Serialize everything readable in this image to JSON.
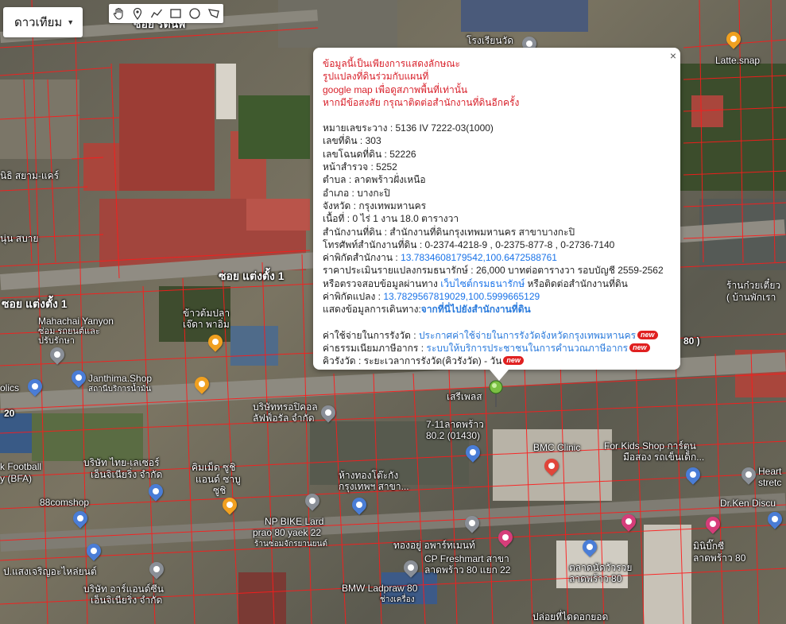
{
  "map_type": {
    "label": "ดาวเทียม"
  },
  "toolbar": {
    "tools": [
      {
        "name": "hand-tool",
        "icon": "hand-icon"
      },
      {
        "name": "marker-tool",
        "icon": "marker-icon"
      },
      {
        "name": "polyline-tool",
        "icon": "polyline-icon"
      },
      {
        "name": "rectangle-tool",
        "icon": "rectangle-icon"
      },
      {
        "name": "circle-tool",
        "icon": "circle-icon"
      },
      {
        "name": "polygon-tool",
        "icon": "polygon-icon"
      }
    ]
  },
  "info": {
    "close": "×",
    "disclaimer": [
      "ข้อมูลนี้เป็นเพียงการแสดงลักษณะ",
      "รูปแปลงที่ดินร่วมกับแผนที่",
      "google map เพื่อดูสภาพพื้นที่เท่านั้น",
      "หากมีข้อสงสัย กรุณาติดต่อสำนักงานที่ดินอีกครั้ง"
    ],
    "fields": [
      {
        "label": "หมายเลขระวาง",
        "value": "5136 IV 7222-03(1000)"
      },
      {
        "label": "เลขที่ดิน",
        "value": "303"
      },
      {
        "label": "เลขโฉนดที่ดิน",
        "value": "52226"
      },
      {
        "label": "หน้าสำรวจ",
        "value": "5252"
      },
      {
        "label": "ตำบล",
        "value": "ลาดพร้าวฝั่งเหนือ"
      },
      {
        "label": "อำเภอ",
        "value": "บางกะปิ"
      },
      {
        "label": "จังหวัด",
        "value": "กรุงเทพมหานคร"
      },
      {
        "label": "เนื้อที่",
        "value": "0 ไร่ 1 งาน 18.0 ตารางวา"
      },
      {
        "label": "สำนักงานที่ดิน",
        "value": "สำนักงานที่ดินกรุงเทพมหานคร สาขาบางกะปิ"
      },
      {
        "label": "โทรศัพท์สำนักงานที่ดิน",
        "value": "0-2374-4218-9 , 0-2375-877-8 , 0-2736-7140"
      }
    ],
    "office_coord_label": "ค่าพิกัดสำนักงาน",
    "office_coord": "13.7834608179542,100.6472588761",
    "price_label": "ราคาประเมินรายแปลงกรมธนารักษ์",
    "price_value": "26,000 บาทต่อตารางวา รอบบัญชี 2559-2562",
    "check_prefix": "หรือตรวจสอบข้อมูลผ่านทาง",
    "check_link": "เว็บไซต์กรมธนารักษ์",
    "check_suffix": "หรือติดต่อสำนักงานที่ดิน",
    "parcel_coord_label": "ค่าพิกัดแปลง",
    "parcel_coord": "13.7829567819029,100.5999665129",
    "route_label": "แสดงข้อมูลการเดินทาง:",
    "route_link": "จากที่นี่ไปยังสำนักงานที่ดิน",
    "fees": [
      {
        "label": "ค่าใช้จ่ายในการรังวัด",
        "value": "ประกาศค่าใช้จ่ายในการรังวัดจังหวัดกรุงเทพมหานคร",
        "badge": "new"
      },
      {
        "label": "ค่าธรรมเนียมภาษีอากร",
        "value": "ระบบให้บริการประชาชนในการคำนวณภาษีอากร",
        "badge": "new"
      },
      {
        "label": "คิวรังวัด",
        "value": "ระยะเวลาการรังวัด(คิวรังวัด) - วัน",
        "badge": "new"
      }
    ]
  },
  "places": {
    "school": "โรงเรียนวัด",
    "latte": "Latte.snap",
    "mahachai": "Mahachai Yanyon",
    "mahachai2": "ซ่อม รถยนต์และ",
    "mahachai3": "ปรับรักษา",
    "khao": "ข้าวต้มปลา",
    "khao2": "เจ๊ดา พาอิ่ม",
    "janthima": "Janthima.Shop",
    "janthima2": "สถานีบริการน้ำมัน",
    "company": "บริษัททรอปิคอล",
    "company2": "ลัฟฟ์อรัล จำกัด",
    "seri": "เสรีเพลส",
    "seven": "7-11ลาดพร้าว",
    "seven2": "80.2 (01430)",
    "bmc": "BMC Clinic",
    "kids": "For Kids Shop การ์ตูน",
    "kids2": "มือสอง รถเข็นเด็ก...",
    "heart": "Heart",
    "heart2": "stretc",
    "thai_laser": "บริษัท ไทย-เลเซอร์",
    "thai_laser2": "เอ็นจิเนียริ่ง จำกัด",
    "computer": "คิมเม็ด ซูชิ",
    "computer2": "แอนด์ ซาบู",
    "computer3": "ซูชิ",
    "gold": "ห้างทองโต๊ะกัง",
    "gold2": "กรุงเทพฯ สาขา...",
    "comshop": "88comshop",
    "npbike": "NP BIKE Lard",
    "npbike2": "prao 80 yaek 22",
    "npbike3": "ร้านซ่อมจักรยานยนต์",
    "drken": "Dr.Ken Discu",
    "thongyoo": "ทองอยู่ อพาร์ทเมนท์",
    "cp": "CP Freshmart สาขา",
    "cp2": "ลาดพร้าว 80 แยก 22",
    "mini": "มินิบิ๊กซี",
    "mini2": "ลาดพร้าว 80",
    "talad": "ตลาดนัดวัวรวย",
    "talad2": "ลาดพร้าว 80",
    "bmw": "BMW Ladpraw 80",
    "bmw2": "ช่างเครื่อง",
    "p_sang": "ป.แสงเจริญอะไหล่ยนต์",
    "aron": "บริษัท อาร์แอนด์ซีน",
    "aron2": "เอ็นจิเนียริ่ง จำกัด",
    "football": "k Football",
    "football2": "y (BFA)",
    "olics": "olics",
    "niti": "นิธิ สยาม-แคร์",
    "noon": "นุ่น สบาย",
    "ruan": "ร้านก๋วยเตี๋ยว",
    "ruan2": "( บ้านพักเรา",
    "pl": "ปล่อยที่ไดดอกยอด",
    "num20": "20",
    "num80": "80 )"
  },
  "roads": {
    "soi1": "ซอย แต่งตั้ง 1",
    "soi1b": "ซอย แต่งตั้ง 1",
    "soi_top": "ซอย รัตนพิ"
  }
}
